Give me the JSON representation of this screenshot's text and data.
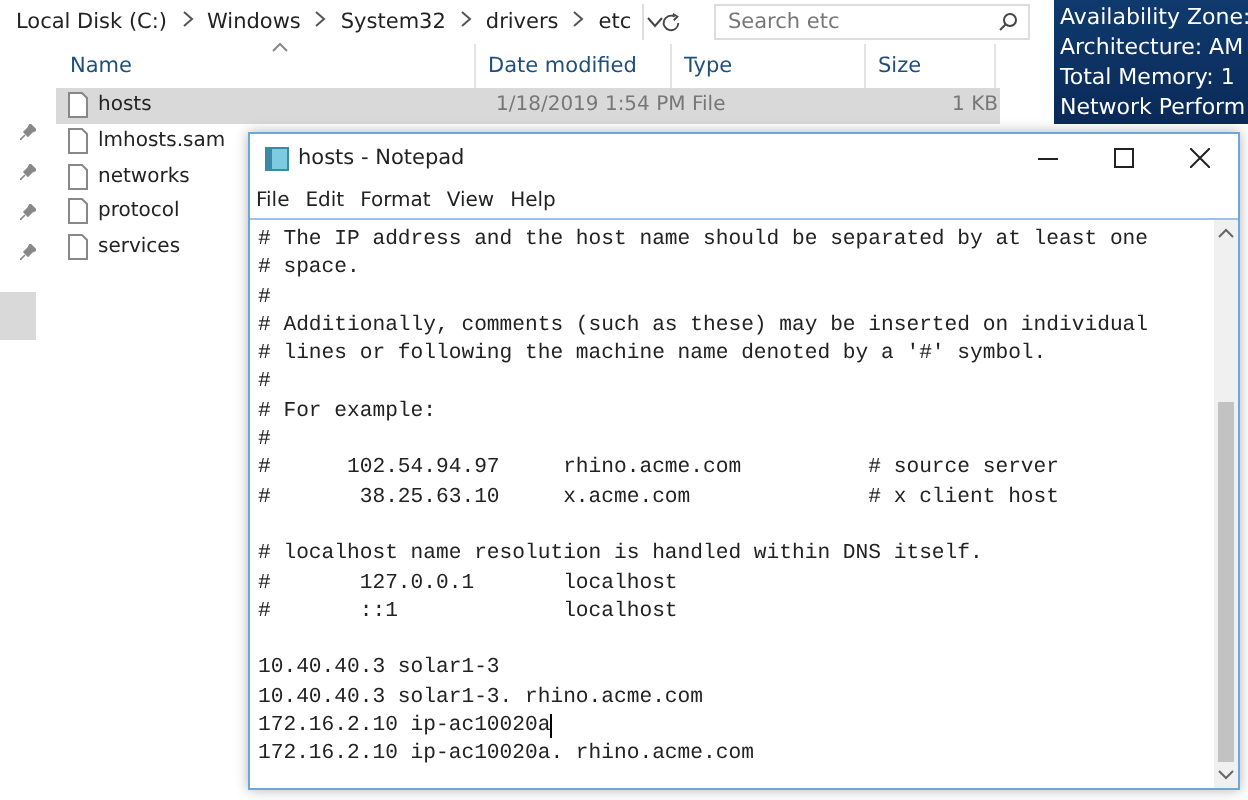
{
  "explorer": {
    "breadcrumb": [
      "Local Disk (C:)",
      "Windows",
      "System32",
      "drivers",
      "etc"
    ],
    "search": {
      "placeholder": "Search etc"
    },
    "columns": [
      "Name",
      "Date modified",
      "Type",
      "Size"
    ],
    "files": [
      {
        "name": "hosts",
        "date": "1/18/2019 1:54 PM",
        "type": "File",
        "size": "1 KB",
        "selected": true
      },
      {
        "name": "lmhosts.sam",
        "selected": false
      },
      {
        "name": "networks",
        "selected": false
      },
      {
        "name": "protocol",
        "selected": false
      },
      {
        "name": "services",
        "selected": false
      }
    ]
  },
  "info_panel": [
    "Availability Zone:",
    "Architecture: AM",
    "Total Memory: 1",
    "Network Perform"
  ],
  "notepad": {
    "title": "hosts - Notepad",
    "menu": [
      "File",
      "Edit",
      "Format",
      "View",
      "Help"
    ],
    "lines": [
      {
        "kind": "text",
        "text": "# The IP address and the host name should be separated by at least one"
      },
      {
        "kind": "text",
        "text": "# space."
      },
      {
        "kind": "text",
        "text": "#"
      },
      {
        "kind": "text",
        "text": "# Additionally, comments (such as these) may be inserted on individual"
      },
      {
        "kind": "text",
        "text": "# lines or following the machine name denoted by a '#' symbol."
      },
      {
        "kind": "text",
        "text": "#"
      },
      {
        "kind": "text",
        "text": "# For example:"
      },
      {
        "kind": "text",
        "text": "#"
      },
      {
        "kind": "text",
        "text": "#      102.54.94.97     rhino.acme.com          # source server"
      },
      {
        "kind": "text",
        "text": "#       38.25.63.10     x.acme.com              # x client host"
      },
      {
        "kind": "blank"
      },
      {
        "kind": "text",
        "text": "# localhost name resolution is handled within DNS itself."
      },
      {
        "kind": "text",
        "text": "#       127.0.0.1       localhost"
      },
      {
        "kind": "text",
        "text": "#       ::1             localhost"
      },
      {
        "kind": "blank"
      },
      {
        "kind": "text",
        "text": "10.40.40.3 solar1-3"
      },
      {
        "kind": "text",
        "text": "10.40.40.3 solar1-3. rhino.acme.com"
      },
      {
        "kind": "text",
        "text": "172.16.2.10 ip-ac10020a",
        "cursor": true
      },
      {
        "kind": "text",
        "text": "172.16.2.10 ip-ac10020a. rhino.acme.com"
      }
    ]
  }
}
